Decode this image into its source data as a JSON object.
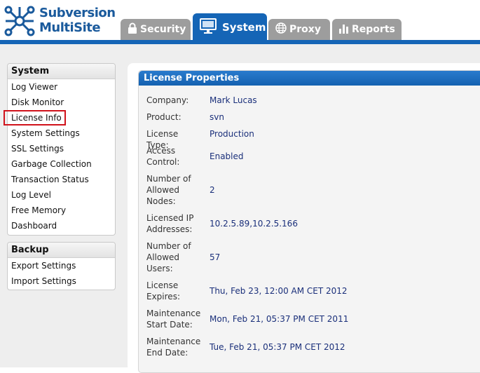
{
  "app": {
    "logo_line1": "Subversion",
    "logo_line2": "MultiSite"
  },
  "colors": {
    "brand_blue": "#1565b6",
    "tab_gray": "#9d9d9d",
    "highlight_red": "#d0121b",
    "value_navy": "#1a2f7a"
  },
  "tabs": [
    {
      "label": "Security",
      "icon": "lock-icon",
      "active": false
    },
    {
      "label": "System",
      "icon": "monitor-icon",
      "active": true
    },
    {
      "label": "Proxy",
      "icon": "globe-icon",
      "active": false
    },
    {
      "label": "Reports",
      "icon": "bar-chart-icon",
      "active": false
    }
  ],
  "sidebar": {
    "system": {
      "title": "System",
      "items": [
        "Log Viewer",
        "Disk Monitor",
        "License Info",
        "System Settings",
        "SSL Settings",
        "Garbage Collection",
        "Transaction Status",
        "Log Level",
        "Free Memory",
        "Dashboard"
      ],
      "active_item": "License Info"
    },
    "backup": {
      "title": "Backup",
      "items": [
        "Export Settings",
        "Import Settings"
      ]
    }
  },
  "license": {
    "title": "License Properties",
    "rows": [
      {
        "label": "Company:",
        "value": "Mark Lucas"
      },
      {
        "label": "Product:",
        "value": "svn"
      },
      {
        "label": "License Type:",
        "value": "Production"
      },
      {
        "label": "Access Control:",
        "value": "Enabled"
      },
      {
        "label": "Number of Allowed Nodes:",
        "value": "2"
      },
      {
        "label": "Licensed IP Addresses:",
        "value": "10.2.5.89,10.2.5.166"
      },
      {
        "label": "Number of Allowed Users:",
        "value": "57"
      },
      {
        "label": "License Expires:",
        "value": "Thu, Feb 23, 12:00 AM CET 2012"
      },
      {
        "label": "Maintenance Start Date:",
        "value": "Mon, Feb 21, 05:37 PM CET 2011"
      },
      {
        "label": "Maintenance End Date:",
        "value": "Tue, Feb 21, 05:37 PM CET 2012"
      }
    ]
  }
}
